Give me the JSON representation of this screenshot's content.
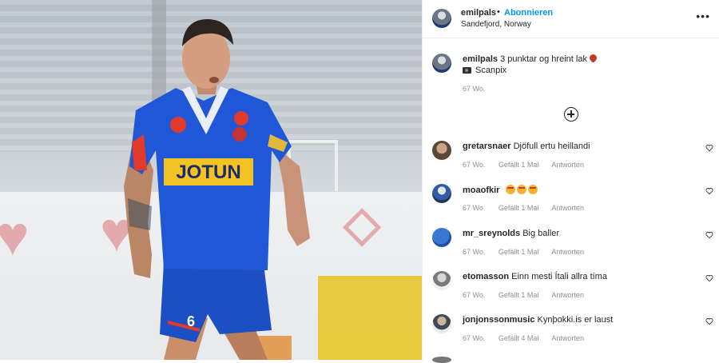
{
  "post": {
    "username": "emilpals",
    "dot": "•",
    "follow_label": "Abonnieren",
    "location": "Sandefjord, Norway",
    "more_label": "•••"
  },
  "caption": {
    "username": "emilpals",
    "text": "3 punktar og hreint lak",
    "credit": "Scanpix",
    "time": "67 Wo."
  },
  "photo": {
    "sponsor": "JOTUN",
    "number": "6"
  },
  "comments": [
    {
      "username": "gretarsnaer",
      "text": "Djöfull ertu heillandi",
      "time": "67 Wo.",
      "likes": "Gefällt 1 Mal",
      "reply": "Antworten"
    },
    {
      "username": "moaofkir",
      "text": "",
      "time": "67 Wo.",
      "likes": "Gefällt 1 Mal",
      "reply": "Antworten"
    },
    {
      "username": "mr_sreynolds",
      "text": "Big baller",
      "time": "67 Wo.",
      "likes": "Gefällt 1 Mal",
      "reply": "Antworten"
    },
    {
      "username": "etomasson",
      "text": "Einn mesti Ítali allra tíma",
      "time": "67 Wo.",
      "likes": "Gefällt 1 Mal",
      "reply": "Antworten"
    },
    {
      "username": "jonjonssonmusic",
      "text": "Kynþokki.is er laust",
      "time": "67 Wo.",
      "likes": "Gefällt 4 Mal",
      "reply": "Antworten"
    }
  ],
  "icons": {
    "more": "more-options-icon",
    "add": "add-comment-icon",
    "like": "heart-outline-icon",
    "camera": "camera-icon"
  }
}
